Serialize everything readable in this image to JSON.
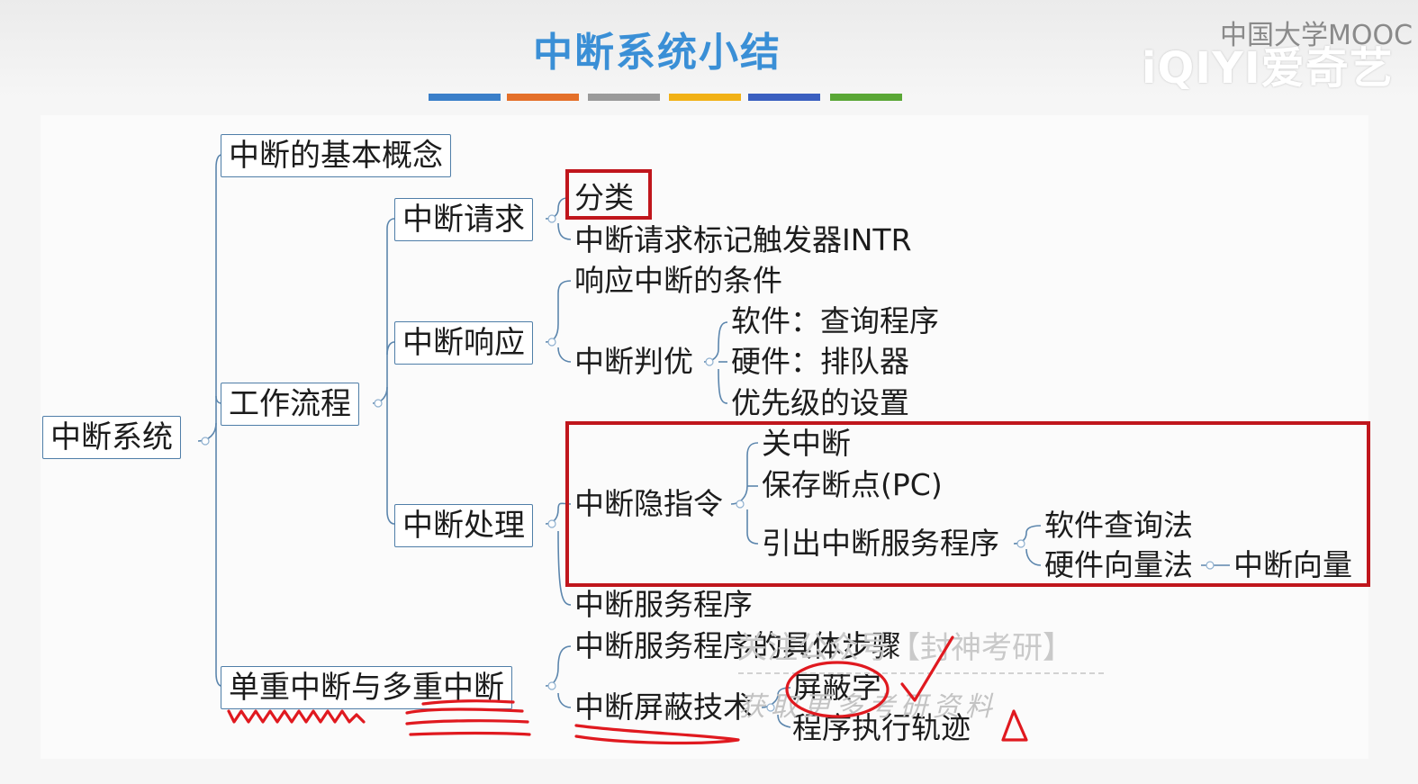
{
  "slide": {
    "title": "中断系统小结",
    "color_bar_colors": [
      "#3a7fc9",
      "#e4702a",
      "#9a9a9a",
      "#f1b116",
      "#3a5fc0",
      "#5aa736"
    ]
  },
  "logo": {
    "mooc_text": "中国大学MOOC",
    "iqiyi_text": "iQIYI爱奇艺"
  },
  "mindmap": {
    "root": "中断系统",
    "basic_concept": "中断的基本概念",
    "workflow": "工作流程",
    "single_multi": "单重中断与多重中断",
    "request": {
      "label": "中断请求",
      "children": [
        "分类",
        "中断请求标记触发器INTR"
      ]
    },
    "response": {
      "label": "中断响应",
      "condition": "响应中断的条件",
      "priority": "中断判优",
      "priority_children": [
        "软件：查询程序",
        "硬件：排队器",
        "优先级的设置"
      ]
    },
    "handling": {
      "label": "中断处理",
      "implicit": "中断隐指令",
      "implicit_children": [
        "关中断",
        "保存断点(PC)",
        "引出中断服务程序"
      ],
      "service_methods": [
        "软件查询法",
        "硬件向量法"
      ],
      "vector": "中断向量",
      "service_routine": "中断服务程序"
    },
    "multi": {
      "steps": "中断服务程序的具体步骤",
      "mask": "中断屏蔽技术",
      "mask_children": [
        "屏蔽字",
        "程序执行轨迹"
      ]
    }
  },
  "watermark": {
    "line1": "关注公众号【封神考研】",
    "line2": "获取更多考研资料"
  },
  "colors": {
    "highlight_box": "#c0161c",
    "annotation_ink": "#e0191f",
    "node_border": "#4f7ea8",
    "connector": "#5c86ad",
    "title": "#3a8fd6"
  }
}
